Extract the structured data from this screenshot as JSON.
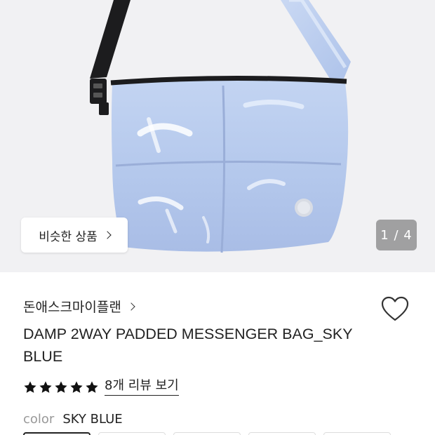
{
  "hero": {
    "similar_button_label": "비슷한 상품",
    "image_counter": "1 / 4",
    "bag_color": "#b8ccee",
    "strap_color": "#1c1c1e",
    "background_color": "#f1f1f3"
  },
  "product": {
    "brand": "돈애스크마이플랜",
    "title": "DAMP 2WAY PADDED MESSENGER BAG_SKY BLUE",
    "rating_stars": 5,
    "review_link": "8개 리뷰 보기",
    "color_label": "color",
    "color_value": "SKY BLUE"
  },
  "icons": {
    "favorite": "heart-outline-icon",
    "star": "star-filled-icon",
    "chevron": "chevron-right-icon"
  }
}
